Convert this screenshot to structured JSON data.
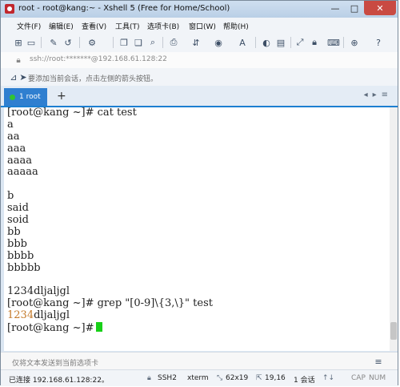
{
  "window": {
    "title": "root - root@kang:~ - Xshell 5 (Free for Home/School)",
    "controls": [
      "—",
      "□",
      "✕"
    ]
  },
  "menu": [
    "文件(F)",
    "编辑(E)",
    "查看(V)",
    "工具(T)",
    "选项卡(B)",
    "窗口(W)",
    "帮助(H)"
  ],
  "address": "ssh://root:*******@192.168.61.128:22",
  "hint": "要添加当前会话，点击左侧的箭头按钮。",
  "tab": {
    "label": "1 root",
    "add": "+"
  },
  "terminal": {
    "lines": [
      "[root@kang ~]# cat test",
      "a",
      "aa",
      "aaa",
      "aaaa",
      "aaaaa",
      "",
      "b",
      "said",
      "soid",
      "bb",
      "bbb",
      "bbbb",
      "bbbbb",
      "",
      "1234dljaljgl",
      "[root@kang ~]# grep \"[0-9]\\{3,\\}\" test"
    ],
    "match": "1234",
    "match_rest": "dljaljgl",
    "prompt": "[root@kang ~]#"
  },
  "send_placeholder": "仅将文本发送到当前选项卡",
  "status": {
    "connection": "已连接 192.168.61.128:22。",
    "protocol": "SSH2",
    "term": "xterm",
    "size": "62x19",
    "pos": "19,16",
    "sessions": "1 会话",
    "cap": "CAP",
    "num": "NUM"
  },
  "colors": {
    "accent": "#2f7fd0",
    "cursor": "#18d018",
    "match": "#c47a2a"
  }
}
